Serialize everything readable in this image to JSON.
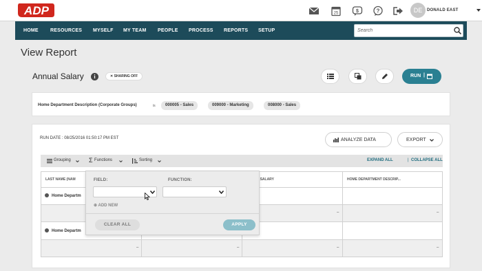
{
  "brand": {
    "logo_text": "ADP",
    "accent": "#d0271d",
    "nav_bg": "#1d4b5a",
    "run_bg": "#2a8092"
  },
  "header": {
    "icons": [
      "mail-icon",
      "calendar-icon",
      "chat-icon",
      "help-icon",
      "sign-out-icon"
    ],
    "calendar_day": "25",
    "user": {
      "initials": "DE",
      "name": "DONALD EAST"
    }
  },
  "nav": {
    "items": [
      "HOME",
      "RESOURCES",
      "MYSELF",
      "MY TEAM",
      "PEOPLE",
      "PROCESS",
      "REPORTS",
      "SETUP"
    ],
    "search_placeholder": "Search"
  },
  "page": {
    "title": "View Report"
  },
  "report": {
    "name": "Annual Salary",
    "sharing": "SHARING OFF",
    "run_label": "RUN"
  },
  "filter": {
    "label": "Home Department Description (Corporate Groups)",
    "operator": "is",
    "values": [
      "000005 - Sales",
      "009000 - Marketing",
      "008000 - Sales"
    ]
  },
  "results": {
    "run_date": "RUN DATE : 08/25/2016 01:50:17 PM EST",
    "analyze_label": "ANALYZE DATA",
    "export_label": "EXPORT",
    "toolbar": {
      "grouping": "Grouping",
      "functions": "Functions",
      "sorting": "Sorting",
      "expand_all": "EXPAND ALL",
      "collapse_all": "COLLAPSE ALL",
      "divider": "|"
    },
    "columns": [
      "LAST NAME (NAM",
      "",
      "UAL SALARY",
      "HOME DEPARTMENT DESCRIP..."
    ],
    "groups": [
      "Home Departm",
      "Home Departm"
    ],
    "empty_value": "–"
  },
  "functions_popup": {
    "field_label": "FIELD:",
    "function_label": "FUNCTION:",
    "add_new": "ADD NEW",
    "clear_all": "CLEAR ALL",
    "apply": "APPLY"
  }
}
